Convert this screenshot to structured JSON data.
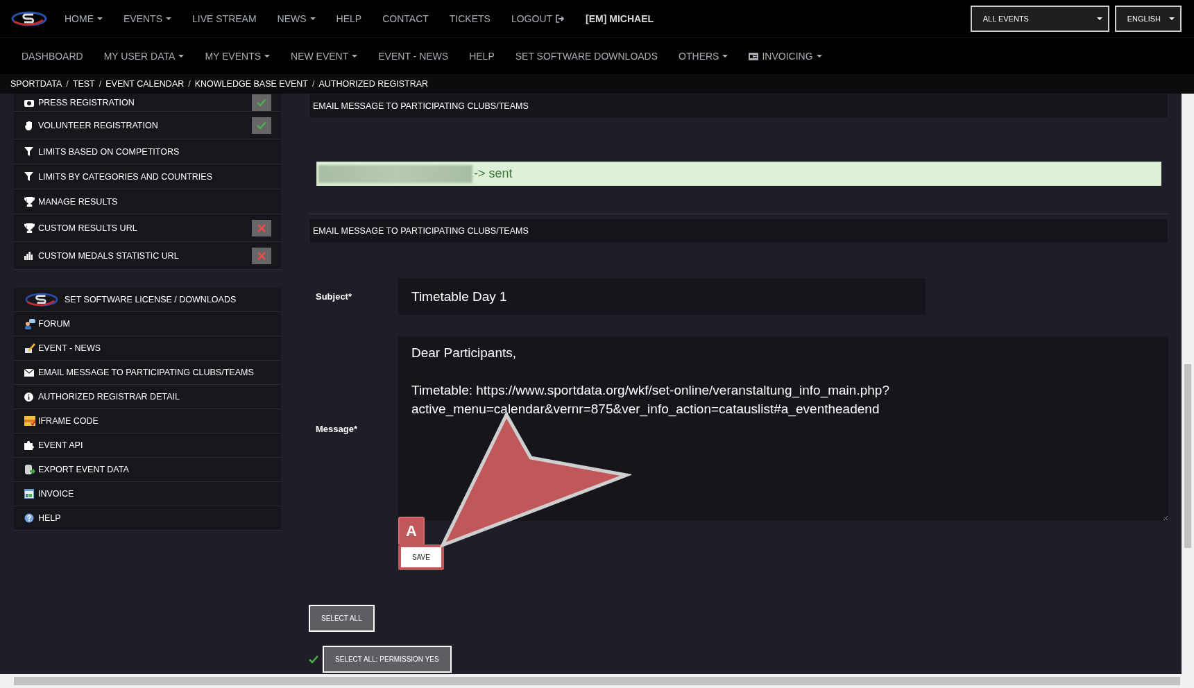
{
  "top_nav": {
    "items": [
      {
        "label": "HOME",
        "dropdown": true,
        "kind": "plain"
      },
      {
        "label": "EVENTS",
        "dropdown": true,
        "kind": "plain"
      },
      {
        "label": "LIVE STREAM",
        "dropdown": false,
        "kind": "plain"
      },
      {
        "label": "NEWS",
        "dropdown": true,
        "kind": "plain"
      },
      {
        "label": "HELP",
        "dropdown": false,
        "kind": "plain"
      },
      {
        "label": "CONTACT",
        "dropdown": false,
        "kind": "plain"
      },
      {
        "label": "TICKETS",
        "dropdown": false,
        "kind": "plain"
      },
      {
        "label": "LOGOUT",
        "dropdown": false,
        "kind": "logout"
      },
      {
        "label": "[EM] MICHAEL",
        "dropdown": false,
        "kind": "user"
      }
    ],
    "event_select": "ALL EVENTS",
    "language_select": "ENGLISH"
  },
  "sub_nav": [
    {
      "label": "DASHBOARD",
      "dropdown": false,
      "kind": "plain"
    },
    {
      "label": "MY USER DATA",
      "dropdown": true,
      "kind": "plain"
    },
    {
      "label": "MY EVENTS",
      "dropdown": true,
      "kind": "plain"
    },
    {
      "label": "NEW EVENT",
      "dropdown": true,
      "kind": "plain"
    },
    {
      "label": "EVENT - NEWS",
      "dropdown": false,
      "kind": "plain"
    },
    {
      "label": "HELP",
      "dropdown": false,
      "kind": "plain"
    },
    {
      "label": "SET SOFTWARE DOWNLOADS",
      "dropdown": false,
      "kind": "plain"
    },
    {
      "label": "OTHERS",
      "dropdown": true,
      "kind": "plain"
    },
    {
      "label": "INVOICING",
      "dropdown": true,
      "kind": "card"
    }
  ],
  "breadcrumb": [
    {
      "label": "SPORTDATA",
      "separator": "/"
    },
    {
      "label": "TEST",
      "separator": "/"
    },
    {
      "label": "EVENT CALENDAR",
      "separator": "/"
    },
    {
      "label": "KNOWLEDGE BASE EVENT",
      "separator": "/"
    },
    {
      "label": "AUTHORIZED REGISTRAR"
    }
  ],
  "sidebar": {
    "groups": [
      [
        {
          "label": "PRESS REGISTRATION",
          "kind": "camera",
          "configured": true
        },
        {
          "label": "VOLUNTEER REGISTRATION",
          "kind": "hand",
          "configured": true
        },
        {
          "label": "LIMITS BASED ON COMPETITORS",
          "kind": "filter"
        },
        {
          "label": "LIMITS BY CATEGORIES AND COUNTRIES",
          "kind": "filter"
        },
        {
          "label": "MANAGE RESULTS",
          "kind": "trophy"
        },
        {
          "label": "CUSTOM RESULTS URL",
          "kind": "trophy",
          "configured": false
        },
        {
          "label": "CUSTOM MEDALS STATISTIC URL",
          "kind": "chart",
          "configured": false
        }
      ],
      [
        {
          "label": "SET SOFTWARE LICENSE / DOWNLOADS",
          "kind": "logo"
        },
        {
          "label": "FORUM",
          "kind": "forum"
        },
        {
          "label": "EVENT - NEWS",
          "kind": "pencil"
        },
        {
          "label": "EMAIL MESSAGE TO PARTICIPATING CLUBS/TEAMS",
          "kind": "mail"
        },
        {
          "label": "AUTHORIZED REGISTRAR DETAIL",
          "kind": "info"
        },
        {
          "label": "IFRAME CODE",
          "kind": "css"
        },
        {
          "label": "EVENT API",
          "kind": "puzzle"
        },
        {
          "label": "EXPORT EVENT DATA",
          "kind": "export"
        },
        {
          "label": "INVOICE",
          "kind": "invoice"
        },
        {
          "label": "HELP",
          "kind": "help"
        }
      ]
    ]
  },
  "main": {
    "section_title_top": "EMAIL MESSAGE TO PARTICIPATING CLUBS/TEAMS",
    "alert": {
      "text": "-> sent",
      "redacted": true
    },
    "section_title": "EMAIL MESSAGE TO PARTICIPATING CLUBS/TEAMS",
    "subject": {
      "label": "Subject*",
      "value": "Timetable Day 1"
    },
    "message": {
      "label": "Message*",
      "value": "Dear Participants,\n\nTimetable: https://www.sportdata.org/wkf/set-online/veranstaltung_info_main.php?active_menu=calendar&vernr=875&ver_info_action=catauslist#a_eventheadend"
    },
    "save_button": "SAVE",
    "annotation_label": "A",
    "select_all_button": "SELECT ALL",
    "permission_button": {
      "label": "SELECT ALL: PERMISSION YES",
      "checked": true
    }
  }
}
